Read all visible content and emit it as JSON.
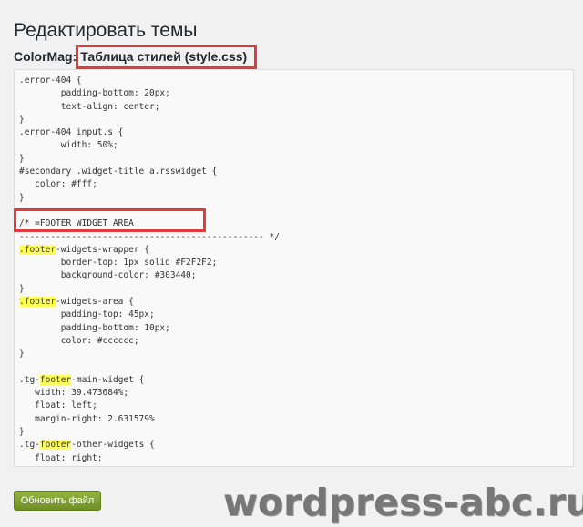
{
  "page": {
    "title": "Редактировать темы"
  },
  "file_heading": {
    "theme_name": "ColorMag:",
    "file_name": "Таблица стилей (style.css)"
  },
  "editor": {
    "lines": [
      [
        {
          "t": ".error-404 {"
        }
      ],
      [
        {
          "t": "        padding-bottom: 20px;"
        }
      ],
      [
        {
          "t": "        text-align: center;"
        }
      ],
      [
        {
          "t": "}"
        }
      ],
      [
        {
          "t": ".error-404 input.s {"
        }
      ],
      [
        {
          "t": "        width: 50%;"
        }
      ],
      [
        {
          "t": "}"
        }
      ],
      [
        {
          "t": "#secondary .widget-title a.rsswidget {"
        }
      ],
      [
        {
          "t": "   color: #fff;"
        }
      ],
      [
        {
          "t": "}"
        }
      ],
      [
        {
          "t": ""
        }
      ],
      [
        {
          "t": "/* =FOOTER WIDGET AREA"
        }
      ],
      [
        {
          "t": "----------------------------------------------- */"
        }
      ],
      [
        {
          "t": ".footer",
          "h": true
        },
        {
          "t": "-widgets-wrapper {"
        }
      ],
      [
        {
          "t": "        border-top: 1px solid #F2F2F2;"
        }
      ],
      [
        {
          "t": "        background-color: #303440;"
        }
      ],
      [
        {
          "t": "}"
        }
      ],
      [
        {
          "t": ".footer",
          "h": true
        },
        {
          "t": "-widgets-area {"
        }
      ],
      [
        {
          "t": "        padding-top: 45px;"
        }
      ],
      [
        {
          "t": "        padding-bottom: 10px;"
        }
      ],
      [
        {
          "t": "        color: #cccccc;"
        }
      ],
      [
        {
          "t": "}"
        }
      ],
      [
        {
          "t": ""
        }
      ],
      [
        {
          "t": ".tg-"
        },
        {
          "t": "footer",
          "h": true
        },
        {
          "t": "-main-widget {"
        }
      ],
      [
        {
          "t": "   width: 39.473684%;"
        }
      ],
      [
        {
          "t": "   float: left;"
        }
      ],
      [
        {
          "t": "   margin-right: 2.631579%"
        }
      ],
      [
        {
          "t": "}"
        }
      ],
      [
        {
          "t": ".tg-"
        },
        {
          "t": "footer",
          "h": true
        },
        {
          "t": "-other-widgets {"
        }
      ],
      [
        {
          "t": "   float: right;"
        }
      ]
    ]
  },
  "buttons": {
    "update_label": "Обновить файл"
  },
  "watermark": {
    "text": "wordpress-abc.ru"
  },
  "colors": {
    "annotation_red": "#e03c3c",
    "highlight_yellow": "#ffff55",
    "button_green": "#7a9c31"
  }
}
